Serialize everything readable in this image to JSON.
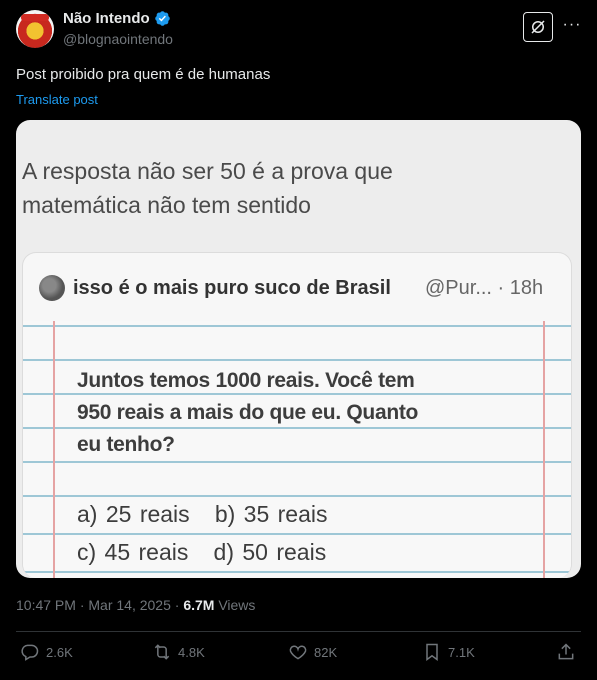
{
  "author": {
    "name": "Não Intendo",
    "handle": "@blognaointendo"
  },
  "post": {
    "text": "Post proibido pra quem é de humanas",
    "translate_label": "Translate post"
  },
  "image": {
    "headline_line1": "A resposta não ser 50 é a prova que",
    "headline_line2": "matemática não tem sentido",
    "quote": {
      "name": "isso é o mais puro suco de Brasil",
      "handle_time": "@Pur... · 18h",
      "question_line1": "Juntos temos 1000 reais. Você tem",
      "question_line2": "950 reais a mais do que eu. Quanto",
      "question_line3": "eu tenho?",
      "answers_row1": "a) 25 reais   b) 35 reais",
      "answers_row2": "c) 45 reais   d) 50 reais"
    }
  },
  "meta": {
    "timestamp": "10:47 PM · Mar 14, 2025 · ",
    "views_count": "6.7M",
    "views_label": " Views"
  },
  "actions": {
    "replies": "2.6K",
    "reposts": "4.8K",
    "likes": "82K",
    "bookmarks": "7.1K"
  },
  "colors": {
    "accent": "#1d9bf0",
    "muted": "#71767b",
    "background": "#000000"
  }
}
